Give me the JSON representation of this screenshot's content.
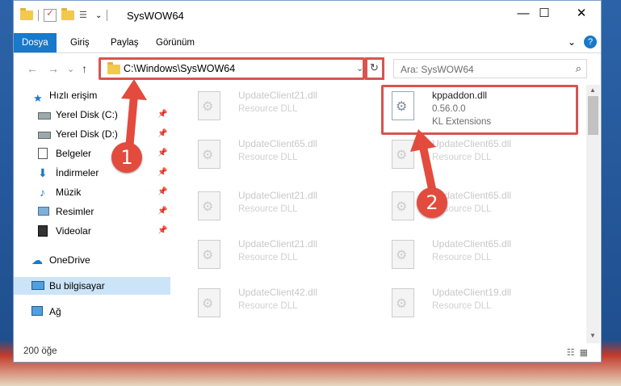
{
  "window": {
    "title": "SysWOW64",
    "controls": {
      "minimize": "—",
      "maximize": "☐",
      "close": "✕"
    }
  },
  "ribbon": {
    "tabs": [
      {
        "label": "Dosya",
        "active": true
      },
      {
        "label": "Giriş"
      },
      {
        "label": "Paylaş"
      },
      {
        "label": "Görünüm"
      }
    ],
    "expand": "⌄",
    "help": "?"
  },
  "nav": {
    "back": "←",
    "forward": "→",
    "recent": "⌄",
    "up": "↑",
    "address": "C:\\Windows\\SysWOW64",
    "address_dropdown": "⌄",
    "refresh": "↻",
    "search_placeholder": "Ara: SysWOW64",
    "search_icon": "⌕"
  },
  "sidebar": {
    "items": [
      {
        "label": "Hızlı erişim",
        "icon": "star-icon"
      },
      {
        "label": "Yerel Disk (C:)",
        "icon": "drive-icon",
        "pin": "📌"
      },
      {
        "label": "Yerel Disk (D:)",
        "icon": "drive-icon",
        "pin": "📌"
      },
      {
        "label": "Belgeler",
        "icon": "documents-icon",
        "pin": "📌"
      },
      {
        "label": "İndirmeler",
        "icon": "download-icon",
        "pin": "📌"
      },
      {
        "label": "Müzik",
        "icon": "music-icon",
        "pin": "📌"
      },
      {
        "label": "Resimler",
        "icon": "pictures-icon",
        "pin": "📌"
      },
      {
        "label": "Videolar",
        "icon": "video-icon",
        "pin": "📌"
      },
      {
        "label": "OneDrive",
        "icon": "cloud-icon"
      },
      {
        "label": "Bu bilgisayar",
        "icon": "computer-icon",
        "selected": true
      },
      {
        "label": "Ağ",
        "icon": "network-icon"
      }
    ]
  },
  "files": [
    {
      "name": "UpdateClient21.dll",
      "desc": "Resource DLL"
    },
    {
      "name": "kppaddon.dll",
      "version": "0.56.0.0",
      "desc": "KL Extensions",
      "highlighted": true
    },
    {
      "name": "UpdateClient65.dll",
      "desc": "Resource DLL"
    },
    {
      "name": "UpdateClient65.dll",
      "desc": "Resource DLL"
    },
    {
      "name": "UpdateClient21.dll",
      "desc": "Resource DLL"
    },
    {
      "name": "UpdateClient65.dll",
      "desc": "Resource DLL"
    },
    {
      "name": "UpdateClient21.dll",
      "desc": "Resource DLL"
    },
    {
      "name": "UpdateClient65.dll",
      "desc": "Resource DLL"
    },
    {
      "name": "UpdateClient42.dll",
      "desc": "Resource DLL"
    },
    {
      "name": "UpdateClient19.dll",
      "desc": "Resource DLL"
    }
  ],
  "status": {
    "count": "200 öğe"
  },
  "annotations": {
    "step1": "1",
    "step2": "2",
    "color": "#e24b3d"
  }
}
